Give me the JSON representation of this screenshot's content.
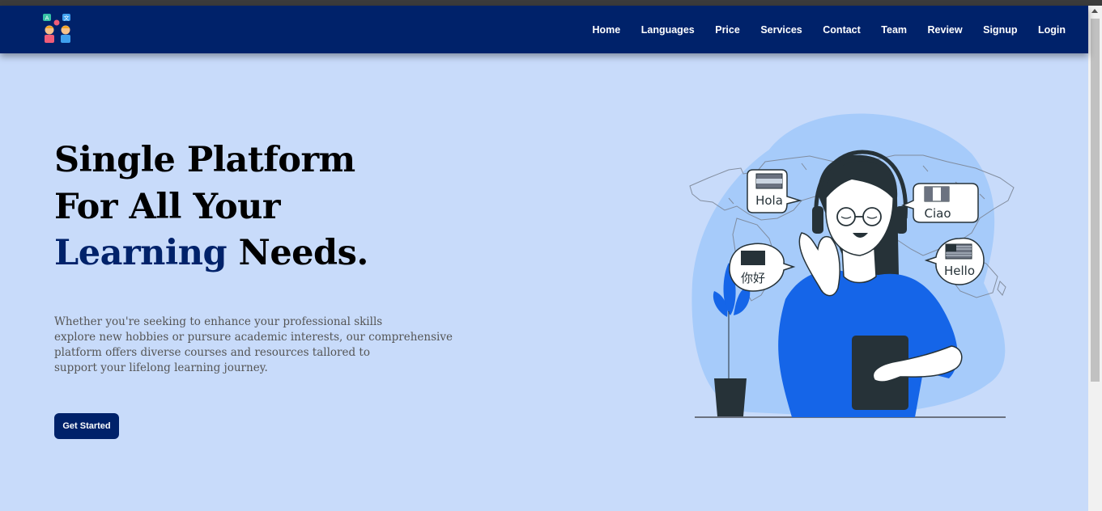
{
  "nav": {
    "items": [
      "Home",
      "Languages",
      "Price",
      "Services",
      "Contact",
      "Team",
      "Review",
      "Signup",
      "Login"
    ]
  },
  "hero": {
    "title_line1": "Single Platform",
    "title_line2": "For All Your",
    "title_accent": "Learning",
    "title_end": " Needs.",
    "description_lines": [
      "Whether you're seeking to enhance your professional skills",
      "explore new hobbies or pursure academic interests, our comprehensive",
      "platform offers diverse courses and resources tallored to",
      "support your lifelong learning journey."
    ],
    "cta_label": "Get Started"
  },
  "illustration": {
    "bubbles": [
      "Hola",
      "Ciao",
      "你好",
      "Hello"
    ]
  },
  "colors": {
    "navbar": "#00226a",
    "background": "#c8dbfa",
    "accent": "#00226a",
    "shirt": "#1565e8"
  },
  "logo": {
    "glyphs": [
      "A",
      "文"
    ]
  }
}
